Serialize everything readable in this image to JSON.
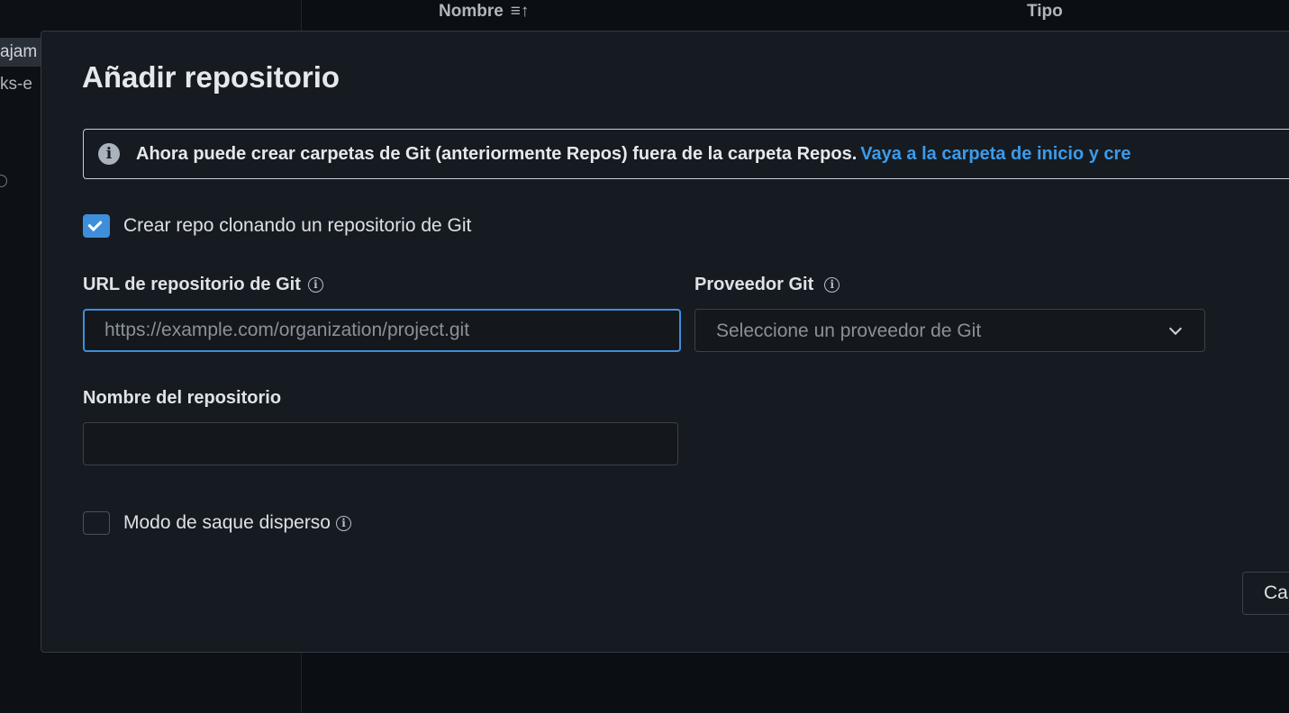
{
  "background": {
    "left_items": [
      "ajam",
      "ks-e"
    ],
    "columns": {
      "name": "Nombre",
      "type": "Tipo"
    },
    "sort_icon": "≡↑"
  },
  "dialog": {
    "title": "Añadir repositorio",
    "banner": {
      "text": "Ahora puede crear carpetas de Git (anteriormente Repos) fuera de la carpeta Repos.",
      "link": "Vaya a la carpeta de inicio y cre"
    },
    "clone_checkbox": {
      "label": "Crear repo clonando un repositorio de Git",
      "checked": true
    },
    "url_field": {
      "label": "URL de repositorio de Git",
      "placeholder": "https://example.com/organization/project.git",
      "value": ""
    },
    "provider_field": {
      "label": "Proveedor Git",
      "placeholder": "Seleccione un proveedor de Git"
    },
    "name_field": {
      "label": "Nombre del repositorio",
      "value": ""
    },
    "sparse_checkbox": {
      "label": "Modo de saque disperso",
      "checked": false
    },
    "cancel_label": "Ca"
  },
  "colors": {
    "accent": "#3f8edc",
    "link": "#3d9be9",
    "dialog_bg": "#161b21"
  }
}
